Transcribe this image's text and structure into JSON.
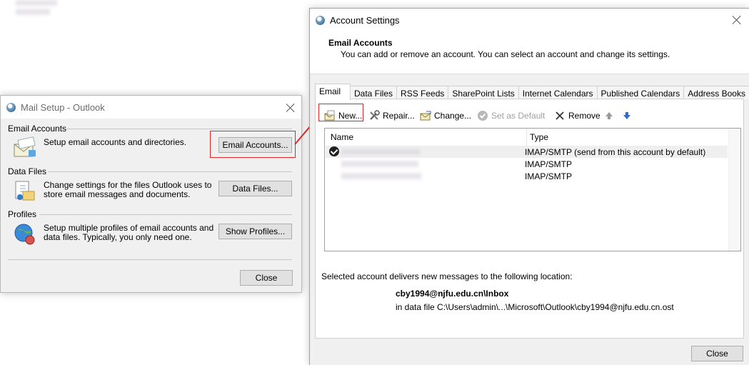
{
  "mail_setup": {
    "title": "Mail Setup - Outlook",
    "email_accounts": {
      "label": "Email Accounts",
      "description": "Setup email accounts and directories.",
      "button": "Email Accounts..."
    },
    "data_files": {
      "label": "Data Files",
      "description": "Change settings for the files Outlook uses to store email messages and documents.",
      "button": "Data Files..."
    },
    "profiles": {
      "label": "Profiles",
      "description": "Setup multiple profiles of email accounts and data files. Typically, you only need one.",
      "button": "Show Profiles..."
    },
    "close_button": "Close"
  },
  "account_settings": {
    "title": "Account Settings",
    "header_title": "Email Accounts",
    "header_subtitle": "You can add or remove an account. You can select an account and change its settings.",
    "tabs": [
      "Email",
      "Data Files",
      "RSS Feeds",
      "SharePoint Lists",
      "Internet Calendars",
      "Published Calendars",
      "Address Books"
    ],
    "toolbar": {
      "new": "New...",
      "repair": "Repair...",
      "change": "Change...",
      "set_default": "Set as Default",
      "remove": "Remove"
    },
    "columns": {
      "name": "Name",
      "type": "Type"
    },
    "accounts": [
      {
        "type": "IMAP/SMTP (send from this account by default)"
      },
      {
        "type": "IMAP/SMTP"
      },
      {
        "type": "IMAP/SMTP"
      }
    ],
    "delivery_label": "Selected account delivers new messages to the following location:",
    "delivery_folder": "cby1994@njfu.edu.cn\\Inbox",
    "delivery_file": "in data file C:\\Users\\admin\\...\\Microsoft\\Outlook\\cby1994@njfu.edu.cn.ost",
    "close_button": "Close"
  },
  "colors": {
    "annotation": "#e02828",
    "selection": "#efefef",
    "button_face": "#e1e1e1"
  }
}
